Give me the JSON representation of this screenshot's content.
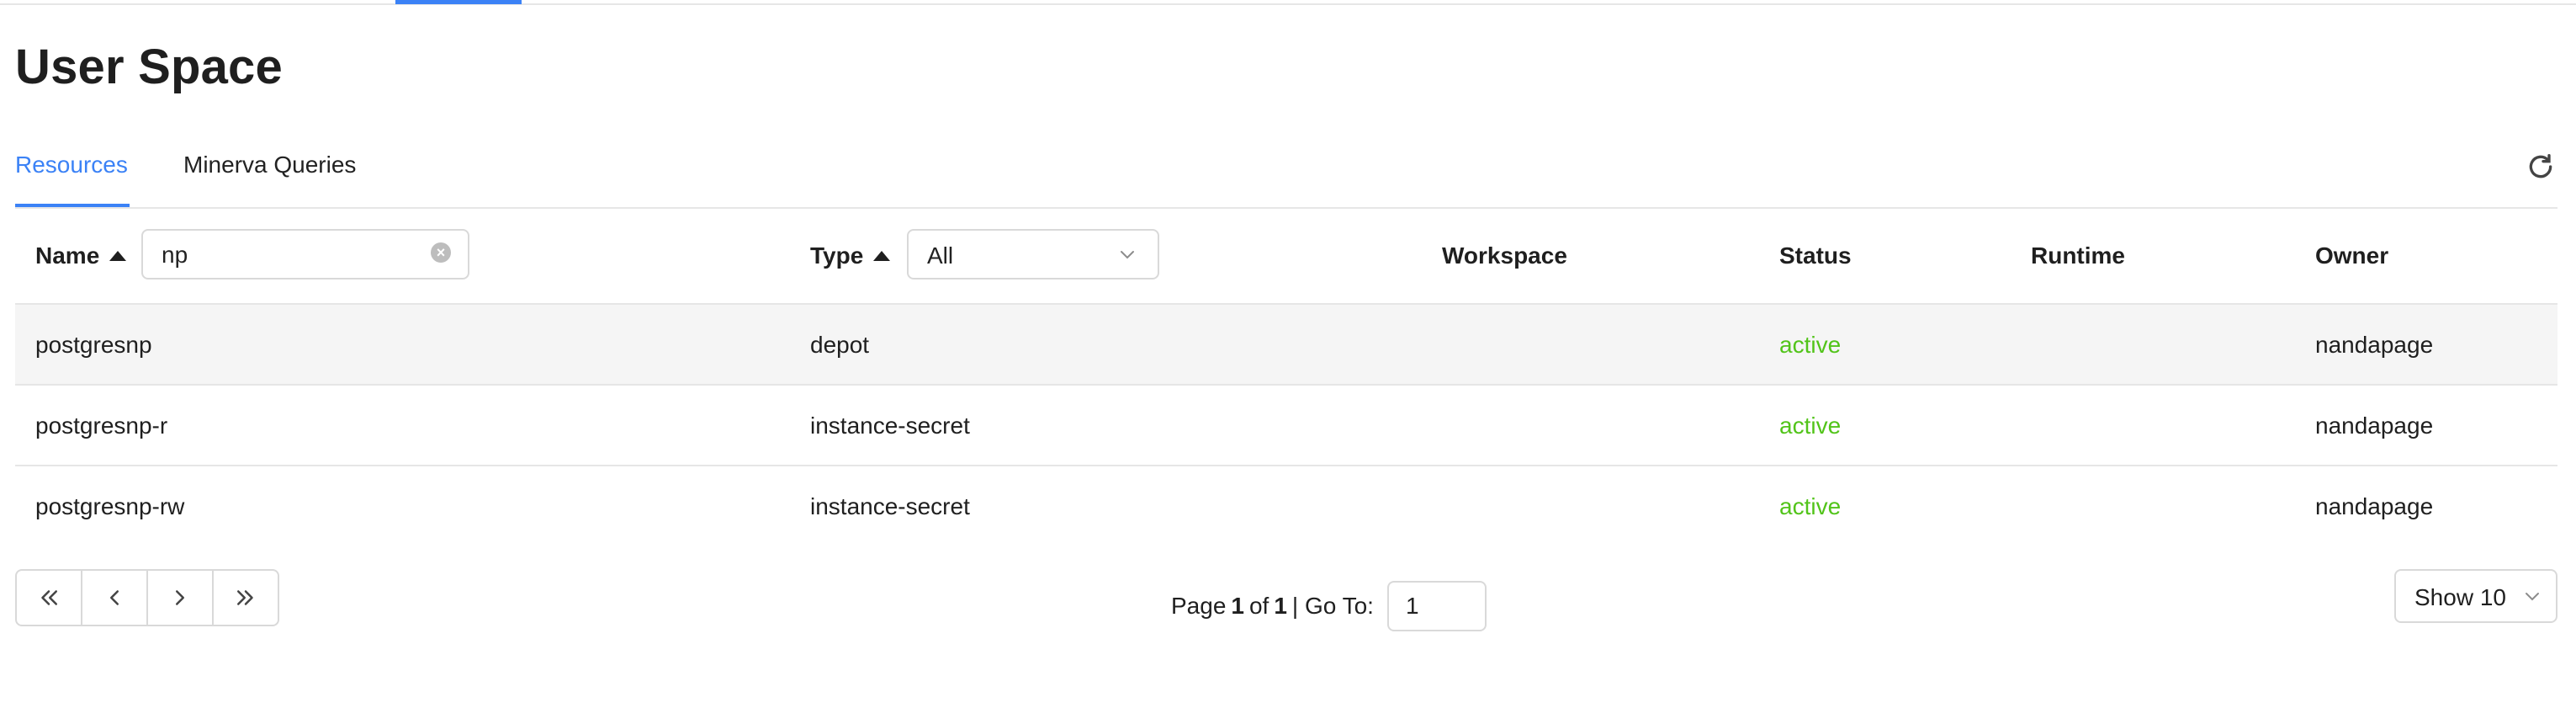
{
  "page": {
    "title": "User Space"
  },
  "tabs": [
    {
      "label": "Resources",
      "active": true
    },
    {
      "label": "Minerva Queries",
      "active": false
    }
  ],
  "toolbar": {
    "refresh_icon": "refresh-icon"
  },
  "table": {
    "columns": [
      {
        "label": "Name",
        "sorted": "ascending"
      },
      {
        "label": "Type",
        "sorted": "ascending"
      },
      {
        "label": "Workspace"
      },
      {
        "label": "Status"
      },
      {
        "label": "Runtime"
      },
      {
        "label": "Owner"
      }
    ],
    "name_filter": {
      "value": "np",
      "clear_icon": "clear-icon"
    },
    "type_filter": {
      "value": "All"
    },
    "rows": [
      {
        "name": "postgresnp",
        "type": "depot",
        "workspace": "",
        "status": "active",
        "runtime": "",
        "owner": "nandapage"
      },
      {
        "name": "postgresnp-r",
        "type": "instance-secret",
        "workspace": "",
        "status": "active",
        "runtime": "",
        "owner": "nandapage"
      },
      {
        "name": "postgresnp-rw",
        "type": "instance-secret",
        "workspace": "",
        "status": "active",
        "runtime": "",
        "owner": "nandapage"
      }
    ]
  },
  "pagination": {
    "page_label": "Page",
    "current": "1",
    "of_label": "of",
    "total": "1",
    "goto_label": "| Go To:",
    "goto_value": "1",
    "page_size_label": "Show 10",
    "buttons": [
      "first-page-icon",
      "prev-page-icon",
      "next-page-icon",
      "last-page-icon"
    ]
  },
  "colors": {
    "accent": "#3b82f6",
    "status_active": "#52c41a",
    "border": "#d9d9d9",
    "row_hover": "#f5f5f5"
  }
}
